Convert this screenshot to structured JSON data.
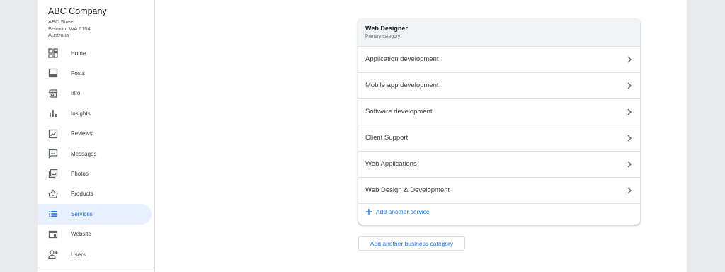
{
  "business": {
    "name": "ABC Company",
    "address": [
      "ABC Street",
      "Belmont WA 6104",
      "Australia"
    ]
  },
  "sidebar": {
    "items": [
      {
        "label": "Home",
        "icon": "dashboard-icon"
      },
      {
        "label": "Posts",
        "icon": "posts-icon"
      },
      {
        "label": "Info",
        "icon": "storefront-icon"
      },
      {
        "label": "Insights",
        "icon": "bar-chart-icon"
      },
      {
        "label": "Reviews",
        "icon": "reviews-icon"
      },
      {
        "label": "Messages",
        "icon": "message-icon"
      },
      {
        "label": "Photos",
        "icon": "photos-icon"
      },
      {
        "label": "Products",
        "icon": "basket-icon"
      },
      {
        "label": "Services",
        "icon": "list-icon",
        "active": true
      },
      {
        "label": "Website",
        "icon": "website-icon"
      },
      {
        "label": "Users",
        "icon": "add-user-icon"
      }
    ]
  },
  "card": {
    "title": "Web Designer",
    "subtitle": "Primary category",
    "services": [
      "Application development",
      "Mobile app development",
      "Software development",
      "Client Support",
      "Web Applications",
      "Web Design & Development"
    ],
    "add_service_label": "Add another service"
  },
  "add_category_label": "Add another business category",
  "colors": {
    "accent": "#1a73e8",
    "active_bg": "#e8f0fe",
    "page_bg": "#e8eaed"
  }
}
